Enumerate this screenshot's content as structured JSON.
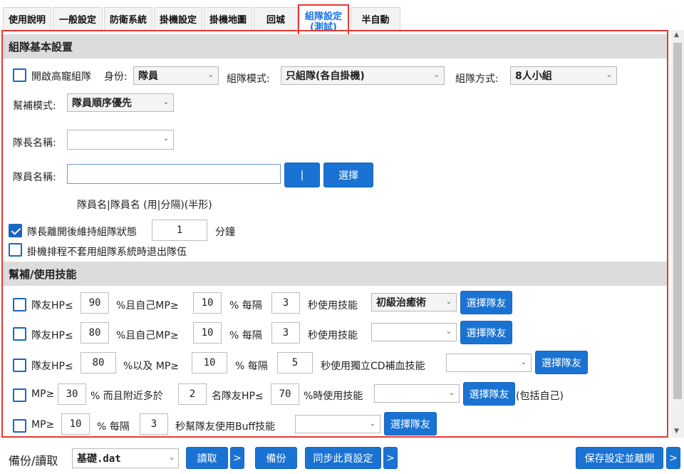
{
  "tabs": [
    {
      "label": "使用說明"
    },
    {
      "label": "一般設定"
    },
    {
      "label": "防衛系統"
    },
    {
      "label": "掛機設定"
    },
    {
      "label": "掛機地圖"
    },
    {
      "label": "回城"
    },
    {
      "label": "組隊設定",
      "sub": "(測試)"
    },
    {
      "label": "半自動"
    }
  ],
  "basic": {
    "header": "組隊基本設置",
    "enable_label": "開啟高寵組隊",
    "identity_label": "身份:",
    "identity_value": "隊員",
    "team_mode_label": "組隊模式:",
    "team_mode_value": "只組隊(各自掛機)",
    "team_type_label": "組隊方式:",
    "team_type_value": "8人小組",
    "help_mode_label": "幫補模式:",
    "help_mode_value": "隊員順序優先",
    "leader_name_label": "隊長名稱:",
    "leader_name_value": "",
    "member_name_label": "隊員名稱:",
    "member_name_value": "",
    "pipe_btn": "|",
    "select_btn": "選擇",
    "member_hint": "隊員名|隊員名 (用|分隔)(半形)",
    "keep_label": "隊長離開後維持組隊狀態",
    "keep_value": "1",
    "keep_unit": "分鐘",
    "keep_checked": true,
    "exit_label": "掛機排程不套用組隊系統時退出隊伍",
    "exit_checked": false
  },
  "skills": {
    "header": "幫補/使用技能",
    "row1": {
      "t1": "隊友HP≤",
      "v1": "90",
      "t2": "%且自己MP≥",
      "v2": "10",
      "t3": "% 每隔",
      "v3": "3",
      "t4": "秒使用技能",
      "skill": "初級治癒術",
      "btn": "選擇隊友"
    },
    "row2": {
      "t1": "隊友HP≤",
      "v1": "80",
      "t2": "%且自己MP≥",
      "v2": "10",
      "t3": "% 每隔",
      "v3": "3",
      "t4": "秒使用技能",
      "skill": "",
      "btn": "選擇隊友"
    },
    "row3": {
      "t1": "隊友HP≤",
      "v1": "80",
      "t2": "%以及 MP≥",
      "v2": "10",
      "t3": "% 每隔",
      "v3": "5",
      "t4": "秒使用獨立CD補血技能",
      "skill": "",
      "btn": "選擇隊友"
    },
    "row4": {
      "t1": "MP≥",
      "v1": "30",
      "t2": "% 而且附近多於",
      "v2": "2",
      "t3": "名隊友HP≤",
      "v3": "70",
      "t4": "%時使用技能",
      "skill": "",
      "btn": "選擇隊友",
      "tail": "(包括自己)"
    },
    "row5": {
      "t1": "MP≥",
      "v1": "10",
      "t2": "% 每隔",
      "v2": "3",
      "t3": "秒幫隊友使用Buff技能",
      "skill": "",
      "btn": "選擇隊友"
    }
  },
  "footer": {
    "backup_label": "備份/讀取",
    "file_value": "基礎.dat",
    "read_btn": "讀取",
    "more1": ">",
    "backup_btn": "備份",
    "sync_btn": "同步此頁設定",
    "more2": ">",
    "save_btn": "保存設定並離開",
    "more3": ">"
  }
}
